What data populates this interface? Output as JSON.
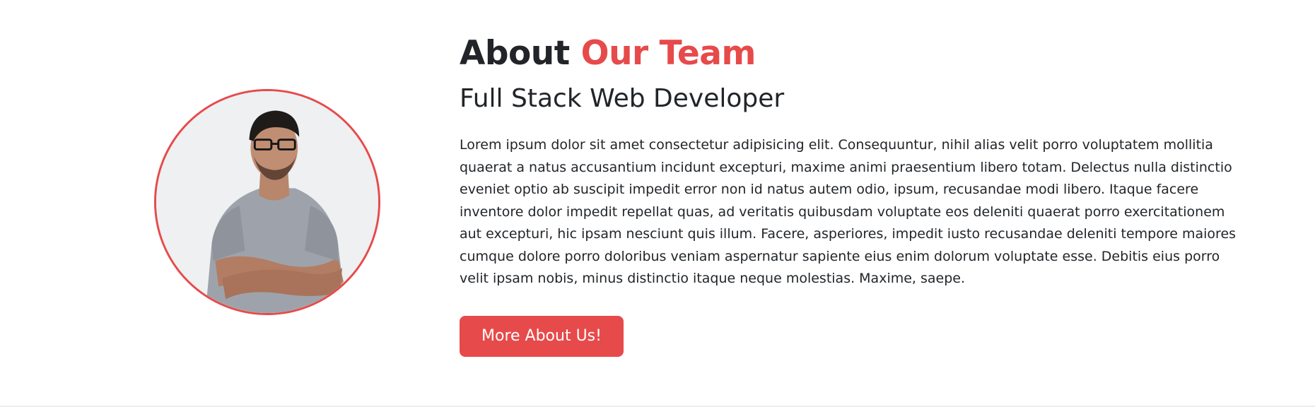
{
  "about": {
    "title_plain": "About",
    "title_accent": "Our Team",
    "subtitle": "Full Stack Web Developer",
    "body": "Lorem ipsum dolor sit amet consectetur adipisicing elit. Consequuntur, nihil alias velit porro voluptatem mollitia quaerat a natus accusantium incidunt excepturi, maxime animi praesentium libero totam. Delectus nulla distinctio eveniet optio ab suscipit impedit error non id natus autem odio, ipsum, recusandae modi libero. Itaque facere inventore dolor impedit repellat quas, ad veritatis quibusdam voluptate eos deleniti quaerat porro exercitationem aut excepturi, hic ipsam nesciunt quis illum. Facere, asperiores, impedit iusto recusandae deleniti tempore maiores cumque dolore porro doloribus veniam aspernatur sapiente eius enim dolorum voluptate esse. Debitis eius porro velit ipsam nobis, minus distinctio itaque neque molestias. Maxime, saepe.",
    "button_label": "More About Us!"
  },
  "colors": {
    "accent": "#e74a4a",
    "text": "#212529",
    "background": "#ffffff"
  }
}
